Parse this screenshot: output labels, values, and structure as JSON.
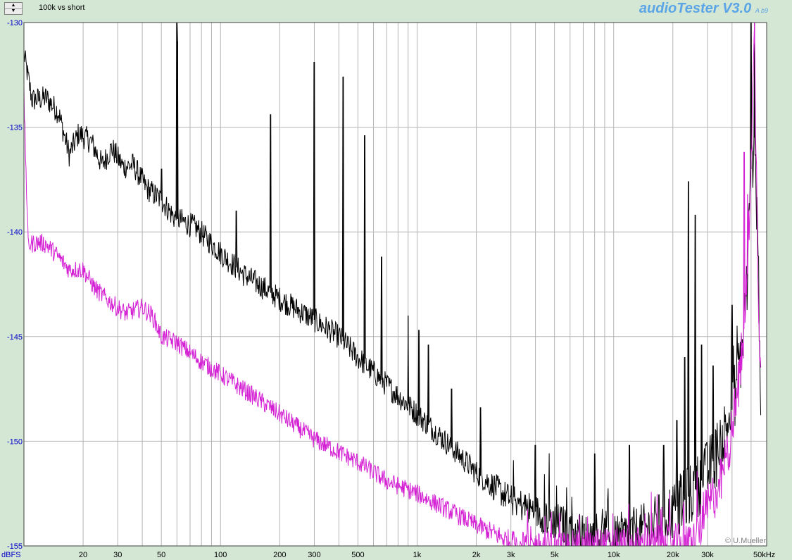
{
  "header": {
    "caption": "100k vs short",
    "brand_name": "audioTester V3.0",
    "brand_build": "A b9",
    "spinner_up": "▲",
    "spinner_down": "▼"
  },
  "footer": {
    "unit_label": "dBFS",
    "freq_unit_label": "50kHz",
    "copyright": "© U.Mueller"
  },
  "colors": {
    "background": "#d4e6d4",
    "plot_bg": "#ffffff",
    "grid": "#b4b4b4",
    "y_tick_text": "#0000c8",
    "brand": "#5aa5e6"
  },
  "chart_data": {
    "type": "line",
    "title": "100k vs short",
    "xlabel": "",
    "ylabel": "dBFS",
    "x_scale": "log",
    "xlim": [
      10,
      60000
    ],
    "ylim": [
      -155,
      -130
    ],
    "grid": true,
    "y_ticks": [
      -130,
      -135,
      -140,
      -145,
      -150,
      -155
    ],
    "x_ticks": [
      {
        "value": 20,
        "label": "20"
      },
      {
        "value": 30,
        "label": "30"
      },
      {
        "value": 50,
        "label": "50"
      },
      {
        "value": 100,
        "label": "100"
      },
      {
        "value": 200,
        "label": "200"
      },
      {
        "value": 300,
        "label": "300"
      },
      {
        "value": 500,
        "label": "500"
      },
      {
        "value": 1000,
        "label": "1k"
      },
      {
        "value": 2000,
        "label": "2k"
      },
      {
        "value": 3000,
        "label": "3k"
      },
      {
        "value": 5000,
        "label": "5k"
      },
      {
        "value": 10000,
        "label": "10k"
      },
      {
        "value": 20000,
        "label": "20k"
      },
      {
        "value": 30000,
        "label": "30k"
      }
    ],
    "series": [
      {
        "color": "#000000",
        "baseline": [
          [
            10,
            -131.5
          ],
          [
            11,
            -133.7
          ],
          [
            13,
            -133.6
          ],
          [
            15,
            -134.3
          ],
          [
            17,
            -136.3
          ],
          [
            19,
            -135.3
          ],
          [
            22,
            -135.7
          ],
          [
            25,
            -136.8
          ],
          [
            28,
            -136.0
          ],
          [
            32,
            -136.9
          ],
          [
            36,
            -136.8
          ],
          [
            42,
            -137.9
          ],
          [
            50,
            -138.5
          ],
          [
            52,
            -138.7
          ],
          [
            58,
            -139.3
          ],
          [
            75,
            -139.8
          ],
          [
            100,
            -141.0
          ],
          [
            130,
            -142.0
          ],
          [
            200,
            -143.2
          ],
          [
            300,
            -144.2
          ],
          [
            400,
            -145.0
          ],
          [
            500,
            -146.0
          ],
          [
            700,
            -147.3
          ],
          [
            1000,
            -148.7
          ],
          [
            1500,
            -150.3
          ],
          [
            2000,
            -151.5
          ],
          [
            3000,
            -152.8
          ],
          [
            5000,
            -153.8
          ],
          [
            7000,
            -154.5
          ],
          [
            10000,
            -154.7
          ],
          [
            15000,
            -154.2
          ],
          [
            20000,
            -153.3
          ],
          [
            25000,
            -152.5
          ],
          [
            30000,
            -151.5
          ],
          [
            35000,
            -150.2
          ],
          [
            40000,
            -148.5
          ],
          [
            45000,
            -145.5
          ],
          [
            48000,
            -142.0
          ],
          [
            50000,
            -137.0
          ],
          [
            52000,
            -135.5
          ],
          [
            54000,
            -140.0
          ],
          [
            56000,
            -147.5
          ]
        ],
        "peaks": [
          [
            50,
            -137.0
          ],
          [
            60,
            -130.0
          ],
          [
            60.5,
            -130.9
          ],
          [
            120,
            -139.0
          ],
          [
            180,
            -134.4
          ],
          [
            300,
            -131.9
          ],
          [
            420,
            -132.6
          ],
          [
            540,
            -135.4
          ],
          [
            660,
            -141.2
          ],
          [
            900,
            -144.0
          ],
          [
            1020,
            -144.7
          ],
          [
            1140,
            -145.4
          ],
          [
            1500,
            -147.5
          ],
          [
            2100,
            -148.4
          ],
          [
            4000,
            -150.2
          ],
          [
            8000,
            -150.6
          ],
          [
            12000,
            -150.2
          ],
          [
            18000,
            -150.2
          ],
          [
            21000,
            -149.0
          ],
          [
            23000,
            -146.0
          ],
          [
            24000,
            -137.6
          ],
          [
            26000,
            -139.2
          ],
          [
            28000,
            -145.4
          ],
          [
            32000,
            -146.4
          ],
          [
            40000,
            -143.5
          ],
          [
            50000,
            -130.0
          ],
          [
            52000,
            -130.0
          ]
        ],
        "noise_amplitude": 0.6
      },
      {
        "color": "#d421d4",
        "baseline": [
          [
            10,
            -133.5
          ],
          [
            10.5,
            -140.6
          ],
          [
            12,
            -140.5
          ],
          [
            13,
            -140.6
          ],
          [
            15,
            -141.2
          ],
          [
            17,
            -141.8
          ],
          [
            20,
            -141.8
          ],
          [
            23,
            -142.7
          ],
          [
            27,
            -143.3
          ],
          [
            33,
            -143.9
          ],
          [
            40,
            -143.6
          ],
          [
            45,
            -144.0
          ],
          [
            50,
            -145.0
          ],
          [
            60,
            -145.3
          ],
          [
            80,
            -146.2
          ],
          [
            100,
            -146.8
          ],
          [
            150,
            -147.9
          ],
          [
            200,
            -148.7
          ],
          [
            300,
            -149.9
          ],
          [
            500,
            -151.0
          ],
          [
            700,
            -151.9
          ],
          [
            1000,
            -152.5
          ],
          [
            2000,
            -154.0
          ],
          [
            3000,
            -154.8
          ],
          [
            4000,
            -155.0
          ],
          [
            25000,
            -155.0
          ],
          [
            30000,
            -153.2
          ],
          [
            35000,
            -152.0
          ],
          [
            40000,
            -149.5
          ],
          [
            45000,
            -146.0
          ],
          [
            48000,
            -142.0
          ],
          [
            50000,
            -136.0
          ],
          [
            52000,
            -131.0
          ],
          [
            54000,
            -141.0
          ],
          [
            56000,
            -147.0
          ]
        ],
        "peaks": [
          [
            46000,
            -136.2
          ],
          [
            48000,
            -138.2
          ],
          [
            52000,
            -130.0
          ]
        ],
        "noise_amplitude": 0.45
      }
    ]
  }
}
